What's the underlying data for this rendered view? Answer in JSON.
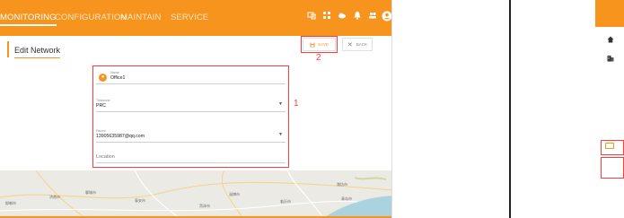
{
  "nav": {
    "items": [
      "MONITORING",
      "CONFIGURATION",
      "MAINTAIN",
      "SERVICE"
    ]
  },
  "page": {
    "title": "Edit Network"
  },
  "toolbar": {
    "save_label": "SAVE",
    "back_label": "BACK"
  },
  "callouts": {
    "form": "1",
    "save": "2"
  },
  "form": {
    "name_label": "Name",
    "name_value": "Office1",
    "timezone_label": "Timezone",
    "timezone_value": "PRC",
    "parent_label": "Parent",
    "parent_value": "13905635987@qq.com",
    "location_placeholder": "Location"
  },
  "map": {
    "cities": [
      "邯郸市",
      "济南市",
      "聊城市",
      "泰安市",
      "淄博市",
      "临沂市",
      "青岛市",
      "潍坊市",
      "菏泽市"
    ]
  },
  "colors": {
    "accent": "#f7941d",
    "callout": "#ff3b3b"
  }
}
